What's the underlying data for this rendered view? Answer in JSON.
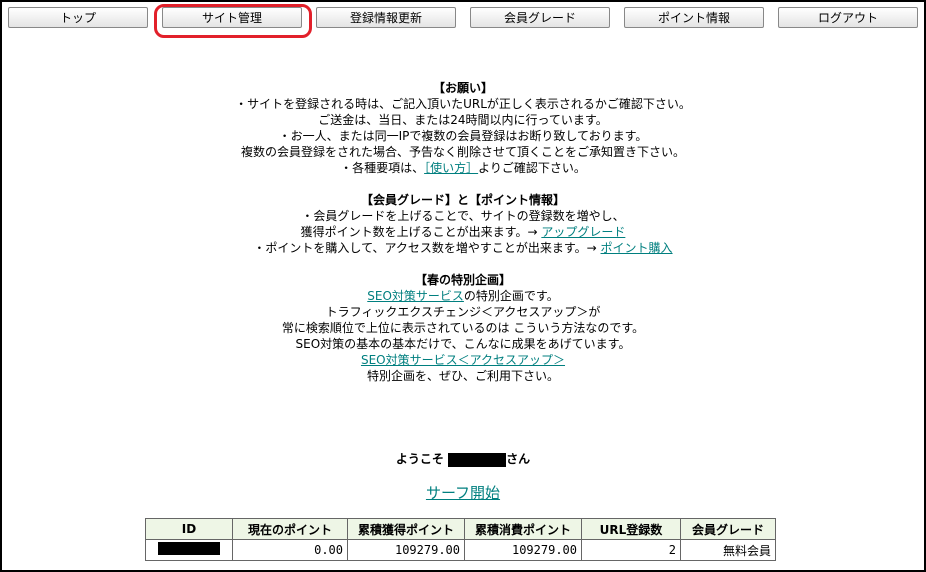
{
  "nav": {
    "items": [
      "トップ",
      "サイト管理",
      "登録情報更新",
      "会員グレード",
      "ポイント情報",
      "ログアウト"
    ]
  },
  "notice": {
    "request_head": "【お願い】",
    "request_lines": [
      "・サイトを登録される時は、ご記入頂いたURLが正しく表示されるかご確認下さい。",
      "ご送金は、当日、または24時間以内に行っています。",
      "・お一人、または同一IPで複数の会員登録はお断り致しております。",
      "複数の会員登録をされた場合、予告なく削除させて頂くことをご承知置き下さい。"
    ],
    "howto_prefix": "・各種要項は、",
    "howto_link": "［使い方］",
    "howto_suffix": "よりご確認下さい。",
    "grade_head": "【会員グレード】と【ポイント情報】",
    "grade_line1": "・会員グレードを上げることで、サイトの登録数を増やし、",
    "grade_line2_prefix": "獲得ポイント数を上げることが出来ます。→ ",
    "grade_line2_link": "アップグレード",
    "grade_line3_prefix": "・ポイントを購入して、アクセス数を増やすことが出来ます。→ ",
    "grade_line3_link": "ポイント購入",
    "spring_head": "【春の特別企画】",
    "spring_line1_link": "SEO対策サービス",
    "spring_line1_suffix": "の特別企画です。",
    "spring_line2": "トラフィックエクスチェンジ＜アクセスアップ＞が",
    "spring_line3": "常に検索順位で上位に表示されているのは こういう方法なのです。",
    "spring_line4": "SEO対策の基本の基本だけで、こんなに成果をあげています。",
    "spring_line5_link": "SEO対策サービス＜アクセスアップ＞",
    "spring_line6": "特別企画を、ぜひ、ご利用下さい。"
  },
  "welcome": {
    "prefix": "ようこそ",
    "suffix": "さん"
  },
  "surf_link": "サーフ開始",
  "stats": {
    "headers": [
      "ID",
      "現在のポイント",
      "累積獲得ポイント",
      "累積消費ポイント",
      "URL登録数",
      "会員グレード"
    ],
    "row": {
      "current_points": "0.00",
      "earned_points": "109279.00",
      "spent_points": "109279.00",
      "url_count": "2",
      "grade": "無料会員"
    }
  },
  "colors": {
    "highlight": "#e2202a",
    "link": "#007f7f",
    "table_header_bg": "#eef6e6"
  }
}
